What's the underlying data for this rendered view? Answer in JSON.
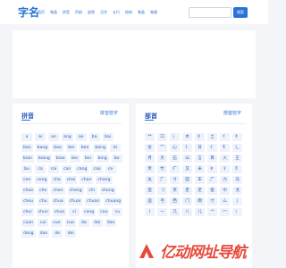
{
  "header": {
    "logo": "字名",
    "nav": [
      "首页",
      "笔画",
      "拼音",
      "声韵",
      "部首",
      "汉字",
      "五行",
      "结构",
      "笔画",
      "笔顺"
    ],
    "search_placeholder": "",
    "search_button": "搜索"
  },
  "pinyin_panel": {
    "title": "拼音",
    "more_link": "拼音检字",
    "items": [
      "a",
      "ai",
      "an",
      "ang",
      "ao",
      "ba",
      "bai",
      "ban",
      "bang",
      "bao",
      "bei",
      "ben",
      "beng",
      "bi",
      "bian",
      "biang",
      "biao",
      "bie",
      "bin",
      "bing",
      "bo",
      "bu",
      "ca",
      "cai",
      "can",
      "cang",
      "cao",
      "ce",
      "cen",
      "ceng",
      "cha",
      "chai",
      "chan",
      "chang",
      "chao",
      "che",
      "chen",
      "cheng",
      "chi",
      "chong",
      "chou",
      "chu",
      "chua",
      "chuai",
      "chuan",
      "chuang",
      "chui",
      "chun",
      "chuo",
      "ci",
      "cong",
      "cou",
      "cu",
      "cuan",
      "cui",
      "cun",
      "cuo",
      "da",
      "dai",
      "dan",
      "dang",
      "dao",
      "de",
      "dei"
    ]
  },
  "radical_panel": {
    "title": "部首",
    "more_link": "部首检字",
    "items": [
      "艹",
      "口",
      "氵",
      "木",
      "扌",
      "土",
      "亻",
      "纟",
      "女",
      "宀",
      "心",
      "讠",
      "日",
      "忄",
      "钅",
      "辶",
      "月",
      "贝",
      "石",
      "山",
      "言",
      "目",
      "火",
      "王",
      "禾",
      "竹",
      "疒",
      "又",
      "米",
      "衤",
      "彳",
      "阝",
      "攵",
      "厂",
      "寸",
      "田",
      "车",
      "广",
      "力",
      "马",
      "虫",
      "刂",
      "页",
      "走",
      "足",
      "金",
      "巾",
      "戈",
      "皿",
      "弓",
      "西",
      "门",
      "雨",
      "寸",
      "厶",
      "丿",
      "丨",
      "一",
      "几",
      "八",
      "儿",
      "亠",
      "冖",
      "冫"
    ]
  },
  "watermark": {
    "text": "亿动网址导航"
  }
}
